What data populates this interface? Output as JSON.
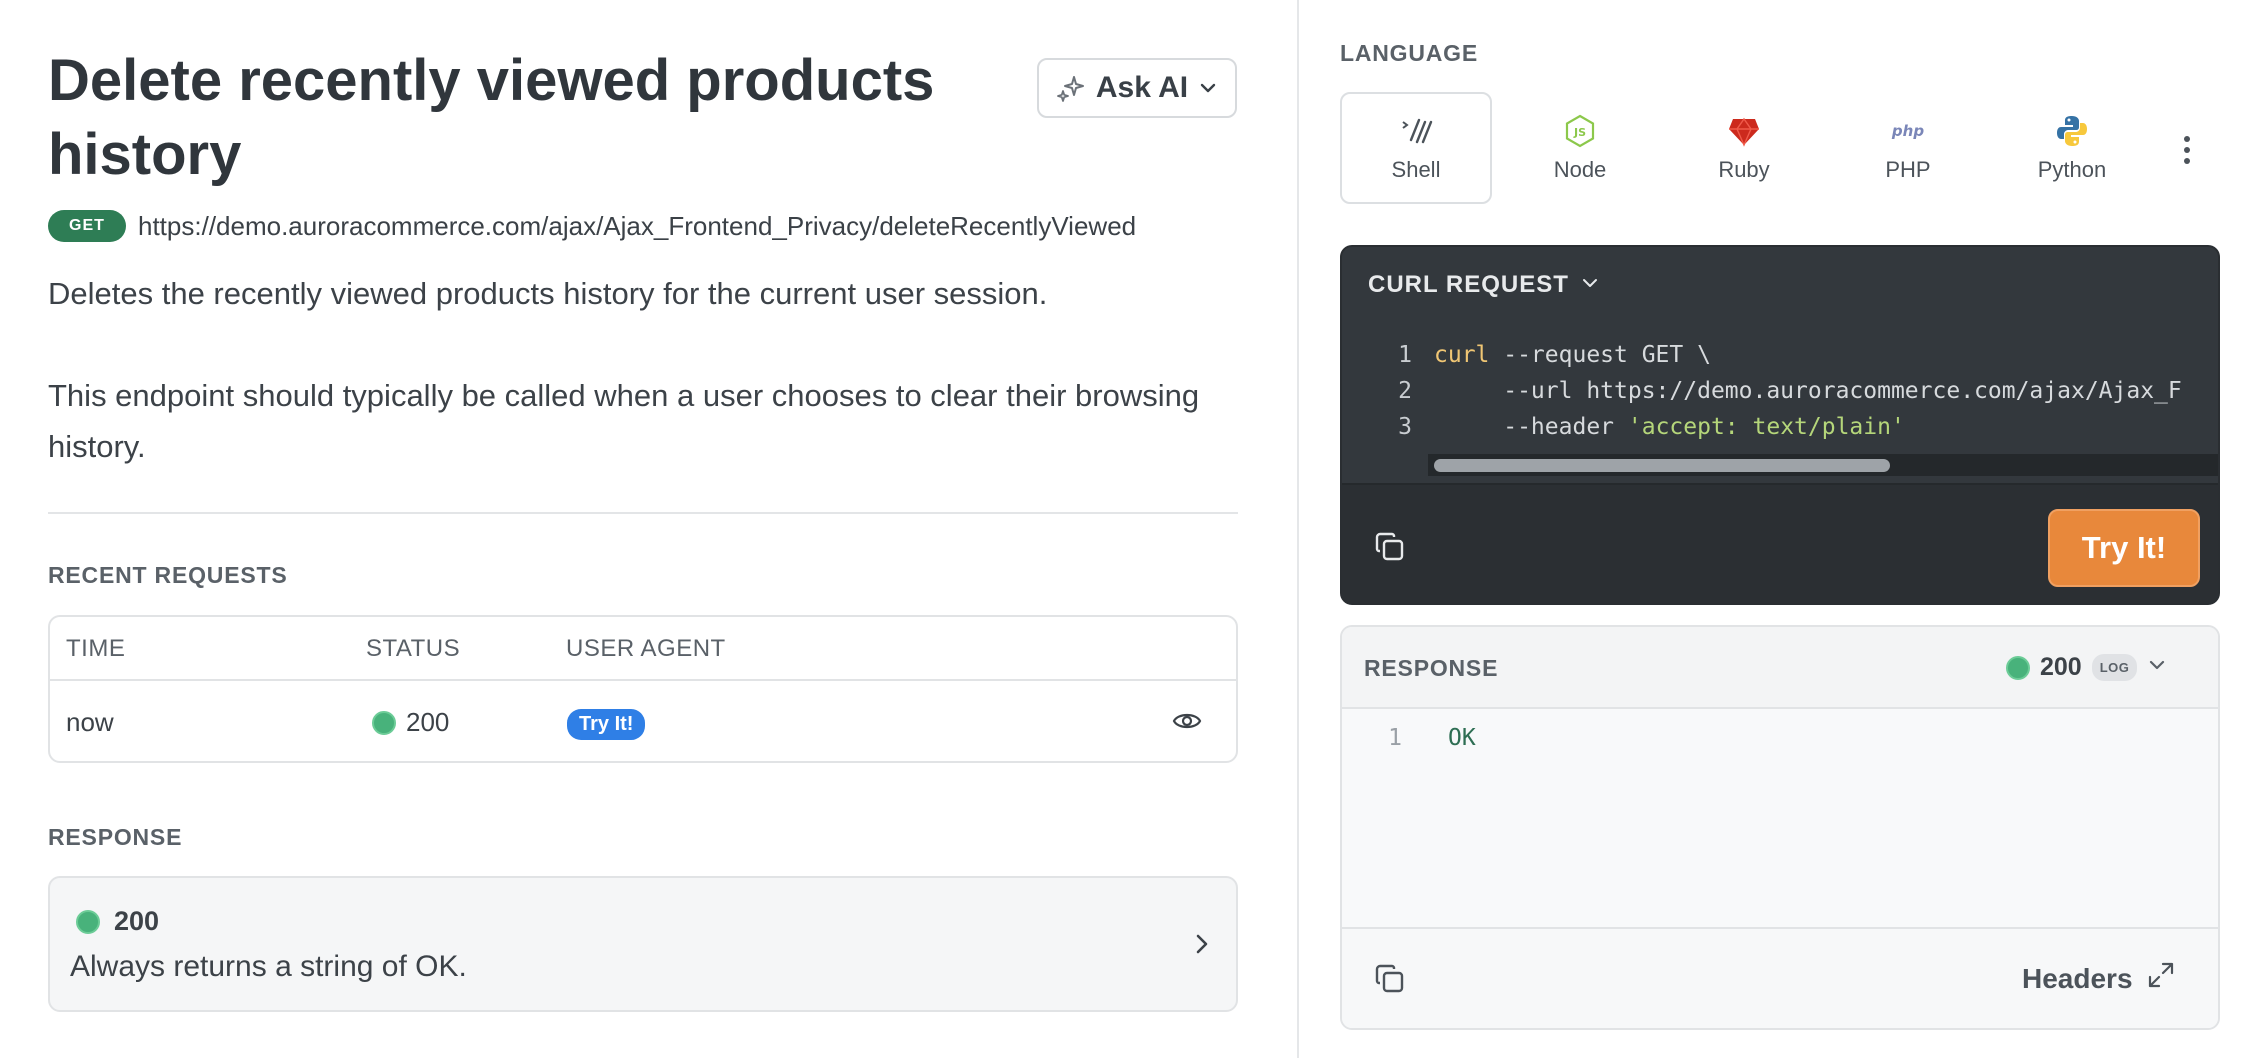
{
  "endpoint": {
    "title": "Delete recently viewed products history",
    "method": "GET",
    "url": "https://demo.auroracommerce.com/ajax/Ajax_Frontend_Privacy/deleteRecentlyViewed",
    "description": [
      "Deletes the recently viewed products history for the current user session.",
      "This endpoint should typically be called when a user chooses to clear their browsing history."
    ]
  },
  "ask_ai": {
    "label": "Ask AI"
  },
  "recent_requests": {
    "heading": "RECENT REQUESTS",
    "columns": [
      "TIME",
      "STATUS",
      "USER AGENT"
    ],
    "rows": [
      {
        "time": "now",
        "status": "200",
        "user_agent": "Try It!"
      }
    ]
  },
  "response_section": {
    "heading": "RESPONSE",
    "code": "200",
    "description": "Always returns a string of OK."
  },
  "language": {
    "heading": "LANGUAGE",
    "options": [
      "Shell",
      "Node",
      "Ruby",
      "PHP",
      "Python"
    ],
    "selected": "Shell"
  },
  "code_sample": {
    "heading": "CURL REQUEST",
    "line_numbers": [
      "1",
      "2",
      "3"
    ],
    "line1_cmd": "curl",
    "line1_rest": " --request GET \\",
    "line2": "     --url https://demo.auroracommerce.com/ajax/Ajax_F",
    "line3_flag": "     --header ",
    "line3_str": "'accept: text/plain'",
    "try_label": "Try It!"
  },
  "response_panel": {
    "heading": "RESPONSE",
    "status": "200",
    "badge": "LOG",
    "line_number": "1",
    "body": "OK",
    "headers_label": "Headers"
  },
  "colors": {
    "success": "#48b27b",
    "method_get": "#2e7d55",
    "try_button": "#e8883b",
    "code_bg": "#33383d",
    "user_agent_badge": "#2f7fe6"
  }
}
